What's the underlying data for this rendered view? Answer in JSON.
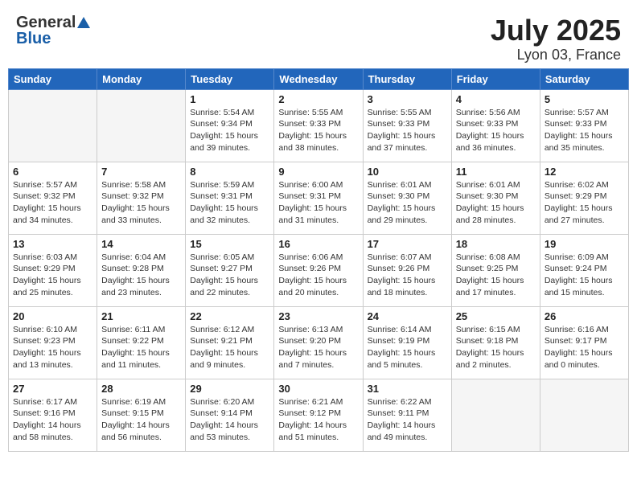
{
  "header": {
    "logo_general": "General",
    "logo_blue": "Blue",
    "title": "July 2025",
    "subtitle": "Lyon 03, France"
  },
  "weekdays": [
    "Sunday",
    "Monday",
    "Tuesday",
    "Wednesday",
    "Thursday",
    "Friday",
    "Saturday"
  ],
  "weeks": [
    [
      {
        "day": "",
        "info": ""
      },
      {
        "day": "",
        "info": ""
      },
      {
        "day": "1",
        "info": "Sunrise: 5:54 AM\nSunset: 9:34 PM\nDaylight: 15 hours\nand 39 minutes."
      },
      {
        "day": "2",
        "info": "Sunrise: 5:55 AM\nSunset: 9:33 PM\nDaylight: 15 hours\nand 38 minutes."
      },
      {
        "day": "3",
        "info": "Sunrise: 5:55 AM\nSunset: 9:33 PM\nDaylight: 15 hours\nand 37 minutes."
      },
      {
        "day": "4",
        "info": "Sunrise: 5:56 AM\nSunset: 9:33 PM\nDaylight: 15 hours\nand 36 minutes."
      },
      {
        "day": "5",
        "info": "Sunrise: 5:57 AM\nSunset: 9:33 PM\nDaylight: 15 hours\nand 35 minutes."
      }
    ],
    [
      {
        "day": "6",
        "info": "Sunrise: 5:57 AM\nSunset: 9:32 PM\nDaylight: 15 hours\nand 34 minutes."
      },
      {
        "day": "7",
        "info": "Sunrise: 5:58 AM\nSunset: 9:32 PM\nDaylight: 15 hours\nand 33 minutes."
      },
      {
        "day": "8",
        "info": "Sunrise: 5:59 AM\nSunset: 9:31 PM\nDaylight: 15 hours\nand 32 minutes."
      },
      {
        "day": "9",
        "info": "Sunrise: 6:00 AM\nSunset: 9:31 PM\nDaylight: 15 hours\nand 31 minutes."
      },
      {
        "day": "10",
        "info": "Sunrise: 6:01 AM\nSunset: 9:30 PM\nDaylight: 15 hours\nand 29 minutes."
      },
      {
        "day": "11",
        "info": "Sunrise: 6:01 AM\nSunset: 9:30 PM\nDaylight: 15 hours\nand 28 minutes."
      },
      {
        "day": "12",
        "info": "Sunrise: 6:02 AM\nSunset: 9:29 PM\nDaylight: 15 hours\nand 27 minutes."
      }
    ],
    [
      {
        "day": "13",
        "info": "Sunrise: 6:03 AM\nSunset: 9:29 PM\nDaylight: 15 hours\nand 25 minutes."
      },
      {
        "day": "14",
        "info": "Sunrise: 6:04 AM\nSunset: 9:28 PM\nDaylight: 15 hours\nand 23 minutes."
      },
      {
        "day": "15",
        "info": "Sunrise: 6:05 AM\nSunset: 9:27 PM\nDaylight: 15 hours\nand 22 minutes."
      },
      {
        "day": "16",
        "info": "Sunrise: 6:06 AM\nSunset: 9:26 PM\nDaylight: 15 hours\nand 20 minutes."
      },
      {
        "day": "17",
        "info": "Sunrise: 6:07 AM\nSunset: 9:26 PM\nDaylight: 15 hours\nand 18 minutes."
      },
      {
        "day": "18",
        "info": "Sunrise: 6:08 AM\nSunset: 9:25 PM\nDaylight: 15 hours\nand 17 minutes."
      },
      {
        "day": "19",
        "info": "Sunrise: 6:09 AM\nSunset: 9:24 PM\nDaylight: 15 hours\nand 15 minutes."
      }
    ],
    [
      {
        "day": "20",
        "info": "Sunrise: 6:10 AM\nSunset: 9:23 PM\nDaylight: 15 hours\nand 13 minutes."
      },
      {
        "day": "21",
        "info": "Sunrise: 6:11 AM\nSunset: 9:22 PM\nDaylight: 15 hours\nand 11 minutes."
      },
      {
        "day": "22",
        "info": "Sunrise: 6:12 AM\nSunset: 9:21 PM\nDaylight: 15 hours\nand 9 minutes."
      },
      {
        "day": "23",
        "info": "Sunrise: 6:13 AM\nSunset: 9:20 PM\nDaylight: 15 hours\nand 7 minutes."
      },
      {
        "day": "24",
        "info": "Sunrise: 6:14 AM\nSunset: 9:19 PM\nDaylight: 15 hours\nand 5 minutes."
      },
      {
        "day": "25",
        "info": "Sunrise: 6:15 AM\nSunset: 9:18 PM\nDaylight: 15 hours\nand 2 minutes."
      },
      {
        "day": "26",
        "info": "Sunrise: 6:16 AM\nSunset: 9:17 PM\nDaylight: 15 hours\nand 0 minutes."
      }
    ],
    [
      {
        "day": "27",
        "info": "Sunrise: 6:17 AM\nSunset: 9:16 PM\nDaylight: 14 hours\nand 58 minutes."
      },
      {
        "day": "28",
        "info": "Sunrise: 6:19 AM\nSunset: 9:15 PM\nDaylight: 14 hours\nand 56 minutes."
      },
      {
        "day": "29",
        "info": "Sunrise: 6:20 AM\nSunset: 9:14 PM\nDaylight: 14 hours\nand 53 minutes."
      },
      {
        "day": "30",
        "info": "Sunrise: 6:21 AM\nSunset: 9:12 PM\nDaylight: 14 hours\nand 51 minutes."
      },
      {
        "day": "31",
        "info": "Sunrise: 6:22 AM\nSunset: 9:11 PM\nDaylight: 14 hours\nand 49 minutes."
      },
      {
        "day": "",
        "info": ""
      },
      {
        "day": "",
        "info": ""
      }
    ]
  ]
}
